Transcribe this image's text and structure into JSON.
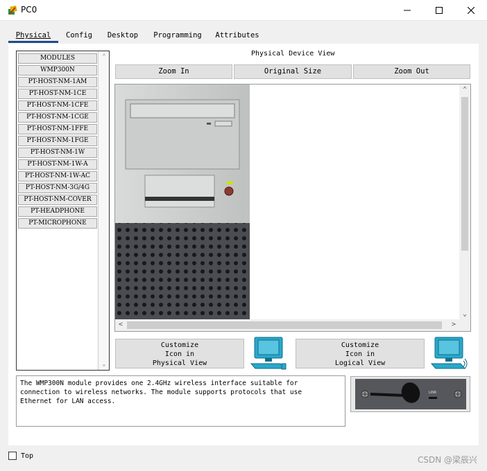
{
  "window": {
    "title": "PC0"
  },
  "tabs": [
    "Physical",
    "Config",
    "Desktop",
    "Programming",
    "Attributes"
  ],
  "active_tab": "Physical",
  "modules": {
    "items": [
      "MODULES",
      "WMP300N",
      "PT-HOST-NM-1AM",
      "PT-HOST-NM-1CE",
      "PT-HOST-NM-1CFE",
      "PT-HOST-NM-1CGE",
      "PT-HOST-NM-1FFE",
      "PT-HOST-NM-1FGE",
      "PT-HOST-NM-1W",
      "PT-HOST-NM-1W-A",
      "PT-HOST-NM-1W-AC",
      "PT-HOST-NM-3G/4G",
      "PT-HOST-NM-COVER",
      "PT-HEADPHONE",
      "PT-MICROPHONE"
    ]
  },
  "device_view": {
    "title": "Physical Device View",
    "zoom_in": "Zoom In",
    "original_size": "Original Size",
    "zoom_out": "Zoom Out"
  },
  "customize": {
    "physical": [
      "Customize",
      "Icon in",
      "Physical View"
    ],
    "logical": [
      "Customize",
      "Icon in",
      "Logical View"
    ]
  },
  "description": "The WMP300N module provides one 2.4GHz wireless interface suitable for\nconnection to wireless networks. The module supports protocols that use\nEthernet for LAN access.",
  "module_image": {
    "label": "LINK"
  },
  "footer": {
    "top_label": "Top",
    "watermark": "CSDN @梁辰兴"
  },
  "colors": {
    "tab_underline": "#1d4b8f",
    "chassis": "#c8cac9",
    "grille": "#4a4c52",
    "power_button": "#8c3a32",
    "led": "#c8e600"
  }
}
